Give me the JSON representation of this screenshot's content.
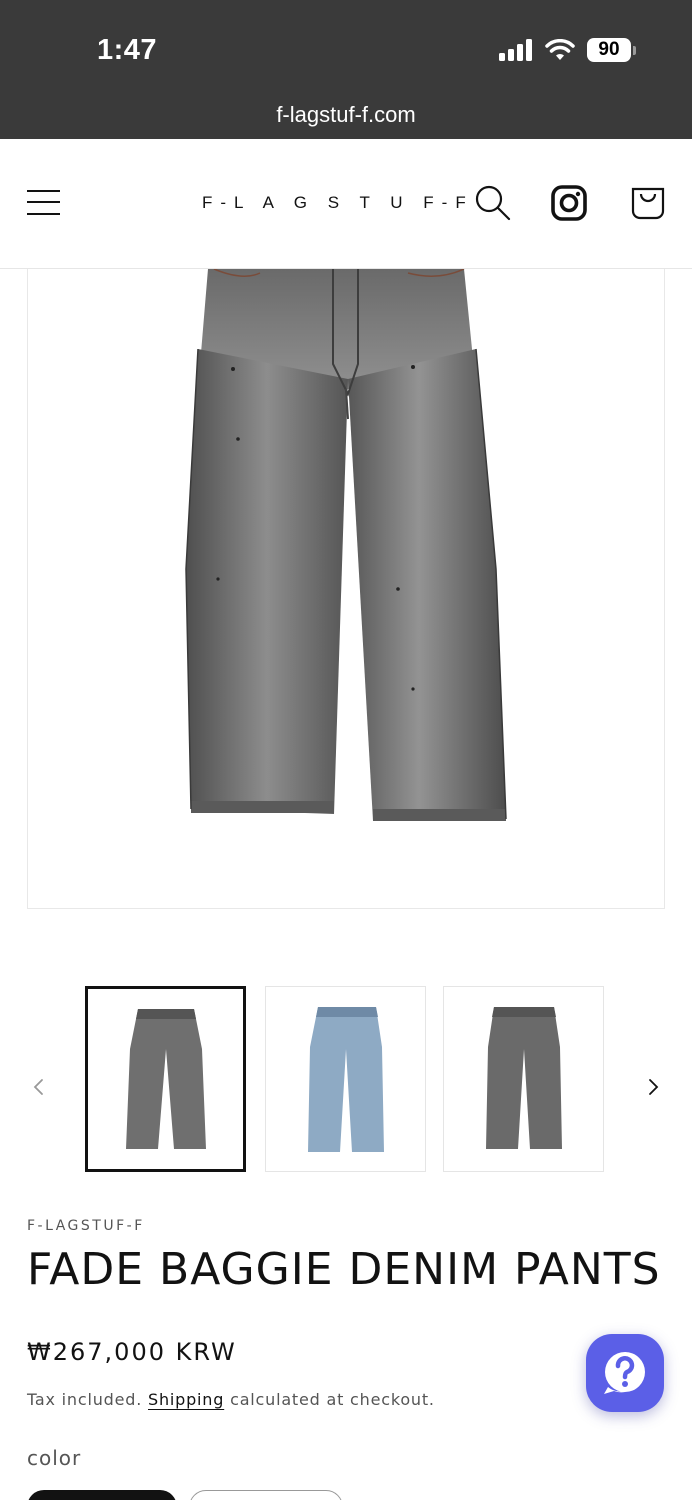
{
  "status_bar": {
    "time": "1:47",
    "battery": "90"
  },
  "browser": {
    "url": "f-lagstuf-f.com"
  },
  "header": {
    "logo": "F-L A G S T U F-F"
  },
  "product": {
    "vendor": "F-LAGSTUF-F",
    "title": "FADE BAGGIE DENIM PANTS",
    "price": "₩267,000 KRW",
    "tax_prefix": "Tax included.",
    "shipping_link": "Shipping",
    "tax_suffix": "calculated at checkout.",
    "option_label": "color"
  },
  "thumbnails": [
    {
      "name": "gray-fade",
      "color": "#6f6f6f"
    },
    {
      "name": "light-blue",
      "color": "#8eaac4"
    },
    {
      "name": "gray-back",
      "color": "#6a6a6a"
    }
  ],
  "colors": {
    "accent": "#5b5fe7",
    "text": "#121212",
    "status_bg": "#3a3a3a",
    "denim_gray": "#6b6b6b"
  }
}
